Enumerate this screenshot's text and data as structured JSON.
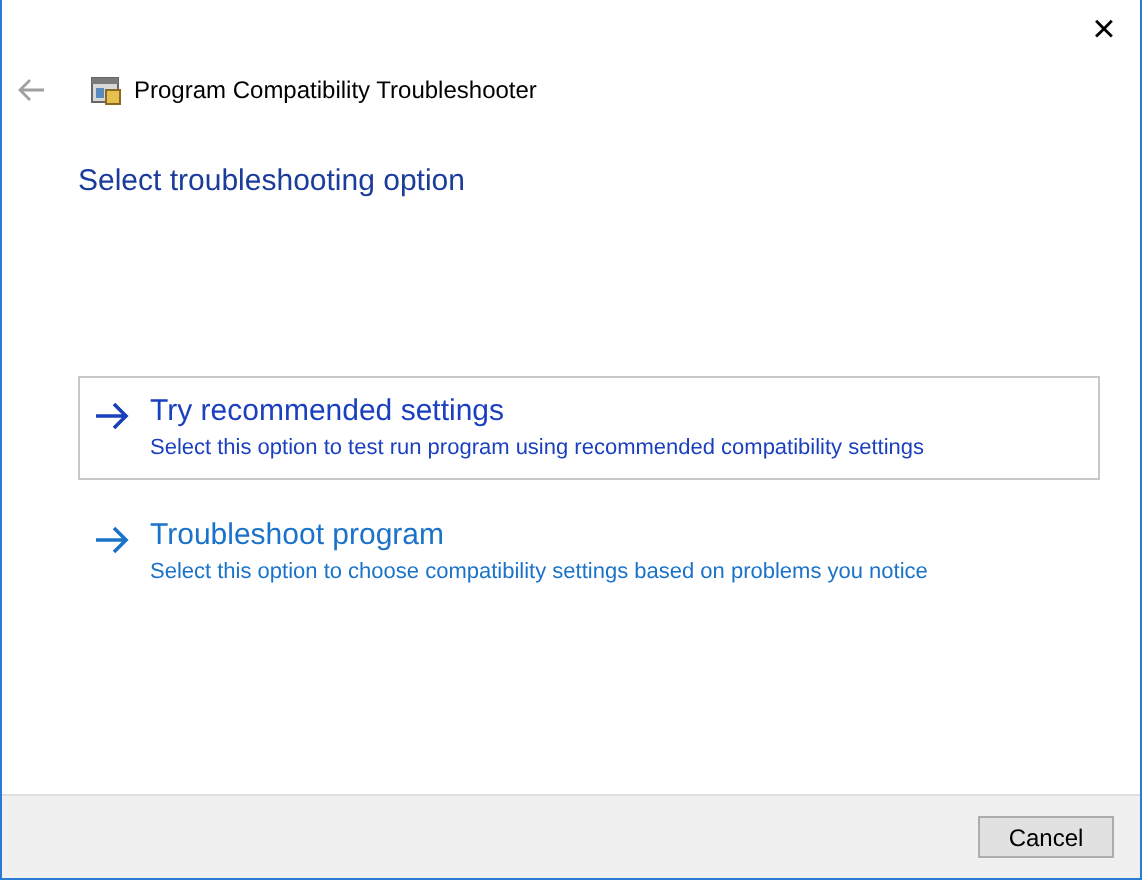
{
  "window": {
    "title": "Program Compatibility Troubleshooter",
    "close": "×"
  },
  "heading": "Select troubleshooting option",
  "options": [
    {
      "title": "Try recommended settings",
      "description": "Select this option to test run program using recommended compatibility settings",
      "selected": true
    },
    {
      "title": "Troubleshoot program",
      "description": "Select this option to choose compatibility settings based on problems you notice",
      "selected": false
    }
  ],
  "buttons": [
    "Cancel"
  ]
}
